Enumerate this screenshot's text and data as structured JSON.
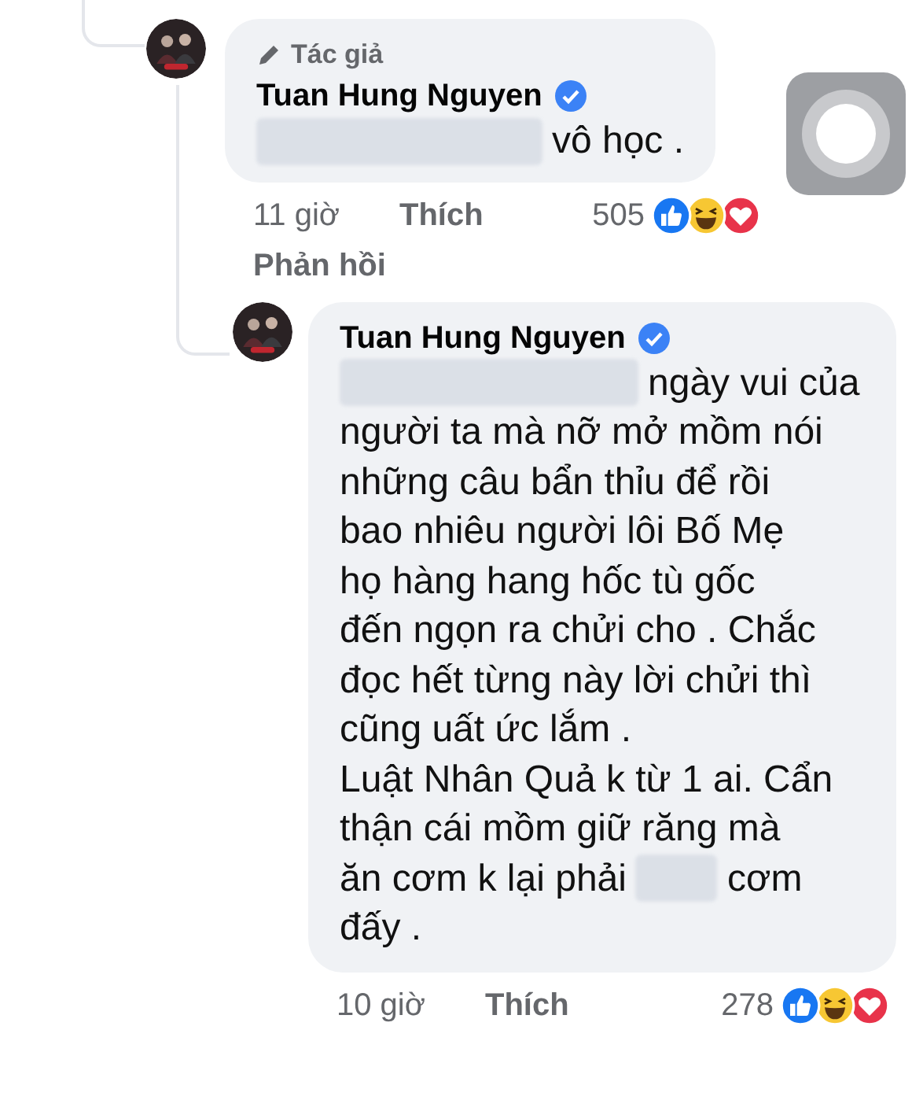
{
  "comments": [
    {
      "badge": "Tác giả",
      "author": "Tuan Hung Nguyen",
      "verified": true,
      "lines": [
        [
          {
            "kind": "redacted"
          },
          {
            "kind": "text",
            "text": "vô học ."
          }
        ]
      ],
      "time": "11 giờ",
      "like": "Thích",
      "reply": "Phản hồi",
      "count": "505"
    },
    {
      "author": "Tuan Hung Nguyen",
      "verified": true,
      "lines": [
        [
          {
            "kind": "redacted"
          },
          {
            "kind": "text",
            "text": "ngày vui của"
          }
        ],
        [
          {
            "kind": "text",
            "text": "người ta mà nỡ mở mồm nói"
          }
        ],
        [
          {
            "kind": "text",
            "text": "những câu bẩn thỉu để rồi"
          }
        ],
        [
          {
            "kind": "text",
            "text": "bao nhiêu người lôi Bố Mẹ"
          }
        ],
        [
          {
            "kind": "text",
            "text": "họ hàng hang hốc tù gốc"
          }
        ],
        [
          {
            "kind": "text",
            "text": "đến ngọn ra chửi cho . Chắc"
          }
        ],
        [
          {
            "kind": "text",
            "text": "đọc hết từng này lời chửi thì"
          }
        ],
        [
          {
            "kind": "text",
            "text": "cũng uất ức lắm ."
          }
        ],
        [
          {
            "kind": "text",
            "text": "Luật Nhân Quả k từ 1 ai. Cẩn"
          }
        ],
        [
          {
            "kind": "text",
            "text": "thận cái mồm giữ răng mà"
          }
        ],
        [
          {
            "kind": "text",
            "text": "ăn cơm k lại phải"
          },
          {
            "kind": "redacted"
          },
          {
            "kind": "text",
            "text": "cơm"
          }
        ],
        [
          {
            "kind": "text",
            "text": "đấy ."
          }
        ]
      ],
      "time": "10 giờ",
      "like": "Thích",
      "count": "278"
    }
  ]
}
